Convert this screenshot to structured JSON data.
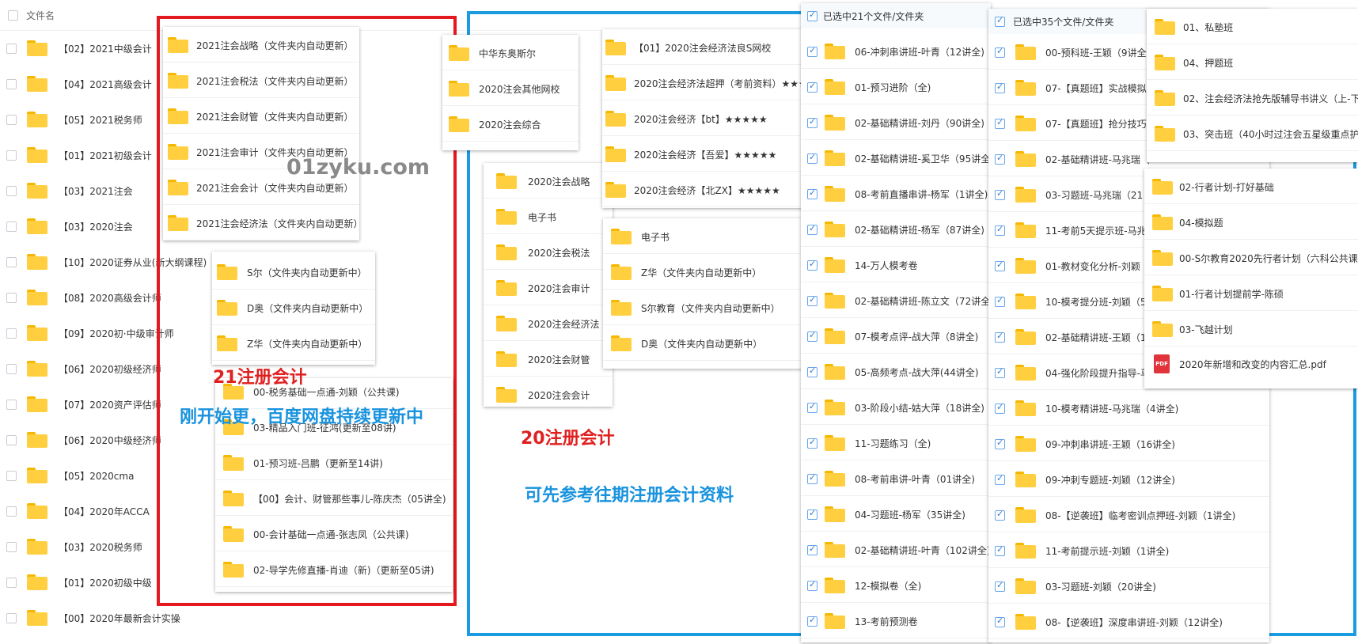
{
  "header": {
    "filename_label": "文件名"
  },
  "main_list": [
    "【02】2021中级会计",
    "【04】2021高级会计",
    "【05】2021税务师",
    "【01】2021初级会计",
    "【03】2021注会",
    "【03】2020注会",
    "【10】2020证券从业(新大纲课程)",
    "【08】2020高级会计师",
    "【09】2020初·中级审计师",
    "【06】2020初级经济师",
    "【07】2020资产评估师",
    "【06】2020中级经济师",
    "【05】2020cma",
    "【04】2020年ACCA",
    "【03】2020税务师",
    "【01】2020初级中级",
    "【00】2020年最新会计实操"
  ],
  "panel_2021": [
    "2021注会战略（文件夹内自动更新）",
    "2021注会税法（文件夹内自动更新）",
    "2021注会财管（文件夹内自动更新）",
    "2021注会审计（文件夹内自动更新）",
    "2021注会会计（文件夹内自动更新）",
    "2021注会经济法（文件夹内自动更新）"
  ],
  "panel_sdz": [
    "S尔（文件夹内自动更新中）",
    "D奥（文件夹内自动更新中）",
    "Z华（文件夹内自动更新中）"
  ],
  "panel_courses": [
    "00-税务基础一点通-刘颖（公共课)",
    "03-精品入门班-征鸿(更新至08讲)",
    "01-预习班-吕鹏（更新至14讲)",
    "【00】会计、财管那些事儿-陈庆杰（05讲全)",
    "00-会计基础一点通-张志凤（公共课)",
    "02-导学先修直播-肖迪（新)（更新至05讲)"
  ],
  "panel_schools": [
    "中华东奥斯尔",
    "2020注会其他网校",
    "2020注会综合"
  ],
  "panel_subjects2020": [
    "2020注会战略",
    "电子书",
    "2020注会税法",
    "2020注会审计",
    "2020注会经济法",
    "2020注会财管",
    "2020注会会计"
  ],
  "panel_jingjifa": [
    "【01】2020注会经济法良S网校",
    "2020注会经济法超押（考前资料）★★★",
    "2020注会经济【bt】★★★★★",
    "2020注会经济【吾爱】★★★★★",
    "2020注会经济【北ZX】★★★★★"
  ],
  "panel_ebooks": [
    "电子书",
    "Z华（文件夹内自动更新中）",
    "S尔教育（文件夹内自动更新中）",
    "D奥（文件夹内自动更新中）"
  ],
  "panel_sel21": {
    "header": "已选中21个文件/文件夹",
    "items": [
      "06-冲刺串讲班-叶青（12讲全)",
      "01-预习进阶（全)",
      "02-基础精讲班-刘丹（90讲全)",
      "02-基础精讲班-奚卫华（95讲全",
      "08-考前直播串讲-杨军（1讲全)",
      "02-基础精讲班-杨军（87讲全)",
      "14-万人模考卷",
      "02-基础精讲班-陈立文（72讲全",
      "07-模考点评-战大萍（8讲全)",
      "05-高频考点-战大萍(44讲全)",
      "03-阶段小结-姑大萍（18讲全)",
      "11-习题练习（全)",
      "08-考前串讲-叶青（01讲全)",
      "04-习题班-杨军（35讲全)",
      "02-基础精讲班-叶青（102讲全)",
      "12-模拟卷（全)",
      "13-考前预测卷"
    ]
  },
  "panel_sel35": {
    "header": "已选中35个文件/文件夹",
    "items": [
      "00-预科班-王颖（9讲全)",
      "07-【真题班】实战模拟",
      "07-【真题班】抢分技巧",
      "02-基础精讲班-马兆瑞（",
      "03-习题班-马兆瑞（21",
      "11-考前5天提示班-马兆",
      "01-教材变化分析-刘颖",
      "10-模考提分班-刘颖（5",
      "02-基础精讲班-王颖（1",
      "04-强化阶段提升指导-马",
      "10-模考精讲班-马兆瑞（4讲全)",
      "09-冲刺串讲班-王颖（16讲全)",
      "09-冲刺专题班-刘颖（12讲全)",
      "08-【逆袭班】临考密训点押班-刘颖（1讲全)",
      "11-考前提示班-刘颖（1讲全)",
      "03-习题班-刘颖（20讲全)",
      "08-【逆袭班】深度串讲班-刘颖（12讲全)"
    ]
  },
  "panel_private": [
    "01、私塾班",
    "04、押题班",
    "02、注会经济法抢先版辅导书讲义（上-下",
    "03、突击班（40小时过注会五星级重点护"
  ],
  "panel_plan": {
    "folders": [
      "02-行者计划-打好基础",
      "04-模拟题",
      "00-S尔教育2020先行者计划（六科公共课",
      "01-行者计划提前学-陈硕",
      "03-飞越计划"
    ],
    "pdf_name": "2020年新增和改变的内容汇总.pdf",
    "pdf_icon_text": "PDF"
  },
  "overlays": {
    "watermark": "01zyku.com",
    "label_21": "21注册会计",
    "label_updating": "刚开始更，百度网盘持续更新中",
    "label_20": "20注册会计",
    "label_ref": "可先参考往期注册会计资料"
  },
  "colors": {
    "red_frame": "#e3191f",
    "blue_frame": "#1b9be0",
    "folder_yellow": "#ffcf40",
    "overlay_blue": "#1993de",
    "overlay_red": "#e02020"
  }
}
